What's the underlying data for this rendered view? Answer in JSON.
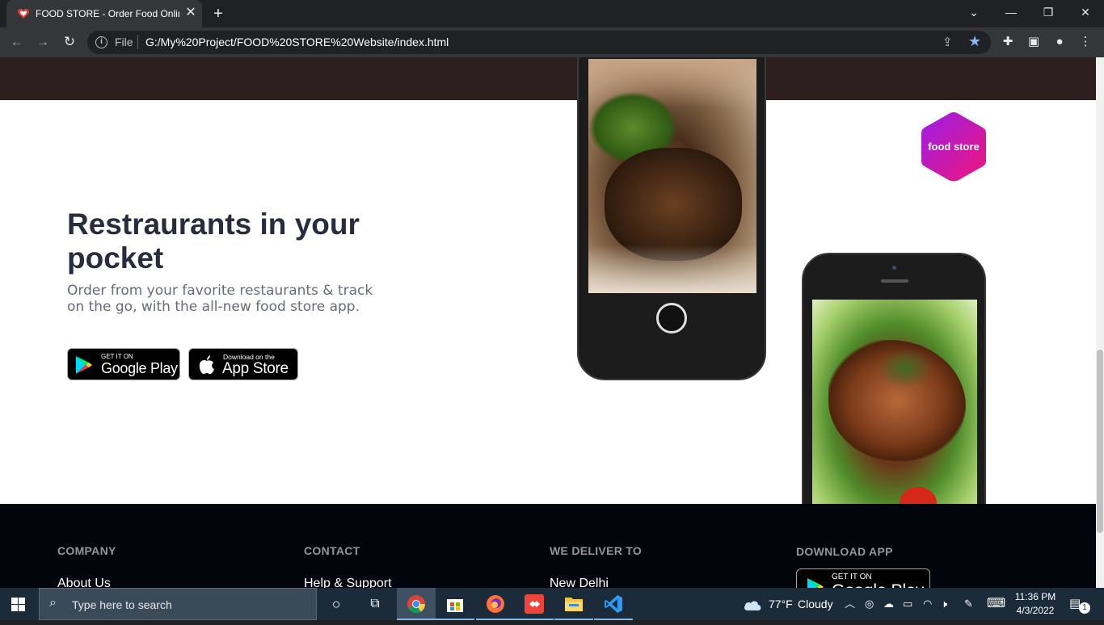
{
  "browser": {
    "tab_title": "FOOD STORE - Order Food Online",
    "tab_close": "✕",
    "new_tab": "+",
    "scheme_label": "File",
    "url": "G:/My%20Project/FOOD%20STORE%20Website/index.html"
  },
  "hero": {
    "headline": "Restraurants in your pocket",
    "subtitle": "Order from your favorite restaurants & track on the go, with the all-new food store app.",
    "google_play": {
      "small": "GET IT ON",
      "big": "Google Play"
    },
    "app_store": {
      "small": "Download on the",
      "big": "App Store"
    },
    "logo_text": "food store"
  },
  "footer": {
    "columns": [
      {
        "heading": "COMPANY",
        "first_link": "About Us"
      },
      {
        "heading": "CONTACT",
        "first_link": "Help & Support"
      },
      {
        "heading": "WE DELIVER TO",
        "first_link": "New Delhi"
      },
      {
        "heading": "DOWNLOAD APP",
        "first_link": ""
      }
    ],
    "badge": {
      "small": "GET IT ON",
      "big": "Google Play"
    }
  },
  "taskbar": {
    "search_placeholder": "Type here to search",
    "weather_temp": "77°F",
    "weather_desc": "Cloudy",
    "time": "11:36 PM",
    "date": "4/3/2022",
    "notification_count": "1"
  },
  "colors": {
    "brand_band": "#2d1f1f",
    "footer_bg": "#02060c",
    "logo_gradient_start": "#9b1ee8",
    "logo_gradient_end": "#f0157a"
  }
}
